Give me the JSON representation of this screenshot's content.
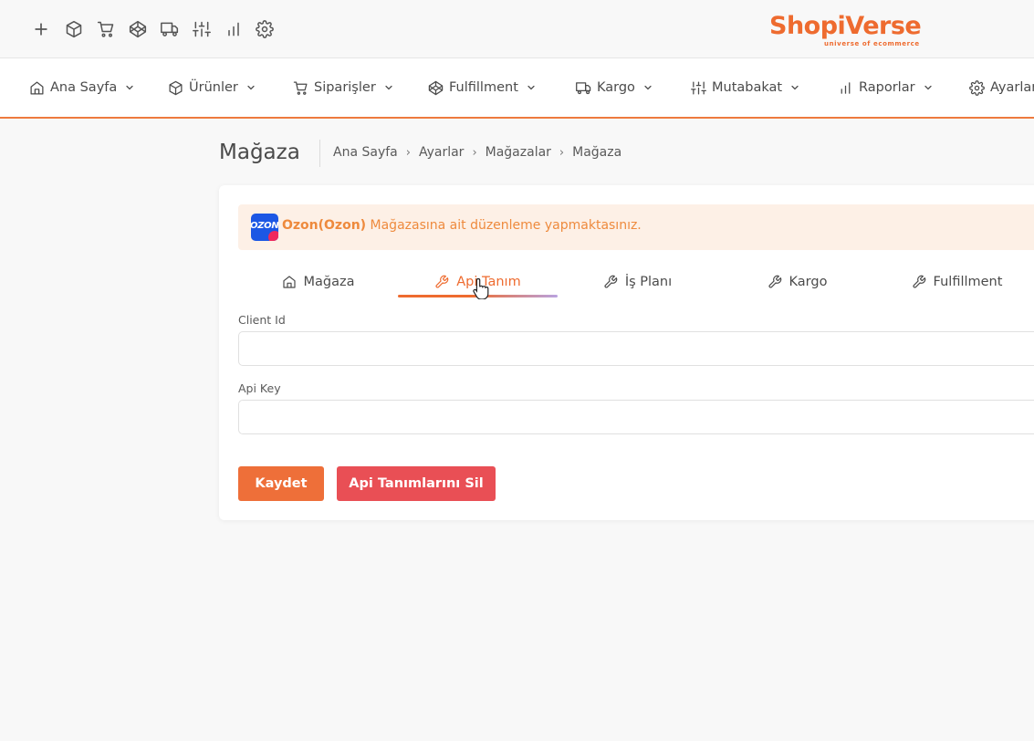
{
  "brand": {
    "name": "ShopiVerse",
    "tagline": "universe of ecommerce",
    "color": "#ee6b2f"
  },
  "toolbar": {
    "icons": [
      "plus-icon",
      "box-icon",
      "cart-icon",
      "codepen-icon",
      "truck-icon",
      "sliders-icon",
      "bar-chart-icon",
      "gear-icon"
    ]
  },
  "nav": {
    "items": [
      {
        "label": "Ana Sayfa",
        "icon": "home-icon"
      },
      {
        "label": "Ürünler",
        "icon": "box-icon"
      },
      {
        "label": "Siparişler",
        "icon": "cart-icon"
      },
      {
        "label": "Fulfillment",
        "icon": "codepen-icon"
      },
      {
        "label": "Kargo",
        "icon": "truck-icon"
      },
      {
        "label": "Mutabakat",
        "icon": "sliders-icon"
      },
      {
        "label": "Raporlar",
        "icon": "bar-chart-icon"
      },
      {
        "label": "Ayarlar",
        "icon": "gear-icon"
      }
    ]
  },
  "page": {
    "title": "Mağaza",
    "breadcrumb": [
      "Ana Sayfa",
      "Ayarlar",
      "Mağazalar",
      "Mağaza"
    ]
  },
  "alert": {
    "store_name": "Ozon(Ozon)",
    "message": " Mağazasına ait düzenleme yapmaktasınız.",
    "logo_text": "OZON"
  },
  "tabs": [
    {
      "label": "Mağaza",
      "icon": "home-icon",
      "active": false
    },
    {
      "label": "Api Tanım",
      "icon": "wrench-icon",
      "active": true
    },
    {
      "label": "İş Planı",
      "icon": "wrench-icon",
      "active": false
    },
    {
      "label": "Kargo",
      "icon": "wrench-icon",
      "active": false
    },
    {
      "label": "Fulfillment",
      "icon": "wrench-icon",
      "active": false
    }
  ],
  "form": {
    "client_id_label": "Client Id",
    "client_id_value": "",
    "api_key_label": "Api Key",
    "api_key_value": ""
  },
  "buttons": {
    "save": "Kaydet",
    "delete": "Api Tanımlarını Sil"
  },
  "colors": {
    "accent": "#ee6b2f",
    "danger": "#e94f55",
    "alert_bg": "#fdf0e6"
  }
}
